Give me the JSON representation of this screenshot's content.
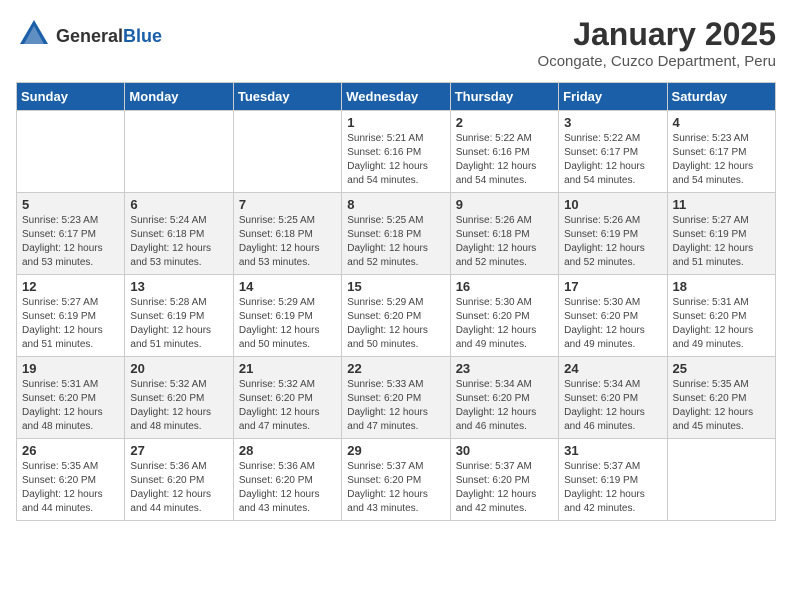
{
  "logo": {
    "general": "General",
    "blue": "Blue"
  },
  "header": {
    "month": "January 2025",
    "location": "Ocongate, Cuzco Department, Peru"
  },
  "weekdays": [
    "Sunday",
    "Monday",
    "Tuesday",
    "Wednesday",
    "Thursday",
    "Friday",
    "Saturday"
  ],
  "weeks": [
    [
      {
        "day": "",
        "sunrise": "",
        "sunset": "",
        "daylight": ""
      },
      {
        "day": "",
        "sunrise": "",
        "sunset": "",
        "daylight": ""
      },
      {
        "day": "",
        "sunrise": "",
        "sunset": "",
        "daylight": ""
      },
      {
        "day": "1",
        "sunrise": "Sunrise: 5:21 AM",
        "sunset": "Sunset: 6:16 PM",
        "daylight": "Daylight: 12 hours and 54 minutes."
      },
      {
        "day": "2",
        "sunrise": "Sunrise: 5:22 AM",
        "sunset": "Sunset: 6:16 PM",
        "daylight": "Daylight: 12 hours and 54 minutes."
      },
      {
        "day": "3",
        "sunrise": "Sunrise: 5:22 AM",
        "sunset": "Sunset: 6:17 PM",
        "daylight": "Daylight: 12 hours and 54 minutes."
      },
      {
        "day": "4",
        "sunrise": "Sunrise: 5:23 AM",
        "sunset": "Sunset: 6:17 PM",
        "daylight": "Daylight: 12 hours and 54 minutes."
      }
    ],
    [
      {
        "day": "5",
        "sunrise": "Sunrise: 5:23 AM",
        "sunset": "Sunset: 6:17 PM",
        "daylight": "Daylight: 12 hours and 53 minutes."
      },
      {
        "day": "6",
        "sunrise": "Sunrise: 5:24 AM",
        "sunset": "Sunset: 6:18 PM",
        "daylight": "Daylight: 12 hours and 53 minutes."
      },
      {
        "day": "7",
        "sunrise": "Sunrise: 5:25 AM",
        "sunset": "Sunset: 6:18 PM",
        "daylight": "Daylight: 12 hours and 53 minutes."
      },
      {
        "day": "8",
        "sunrise": "Sunrise: 5:25 AM",
        "sunset": "Sunset: 6:18 PM",
        "daylight": "Daylight: 12 hours and 52 minutes."
      },
      {
        "day": "9",
        "sunrise": "Sunrise: 5:26 AM",
        "sunset": "Sunset: 6:18 PM",
        "daylight": "Daylight: 12 hours and 52 minutes."
      },
      {
        "day": "10",
        "sunrise": "Sunrise: 5:26 AM",
        "sunset": "Sunset: 6:19 PM",
        "daylight": "Daylight: 12 hours and 52 minutes."
      },
      {
        "day": "11",
        "sunrise": "Sunrise: 5:27 AM",
        "sunset": "Sunset: 6:19 PM",
        "daylight": "Daylight: 12 hours and 51 minutes."
      }
    ],
    [
      {
        "day": "12",
        "sunrise": "Sunrise: 5:27 AM",
        "sunset": "Sunset: 6:19 PM",
        "daylight": "Daylight: 12 hours and 51 minutes."
      },
      {
        "day": "13",
        "sunrise": "Sunrise: 5:28 AM",
        "sunset": "Sunset: 6:19 PM",
        "daylight": "Daylight: 12 hours and 51 minutes."
      },
      {
        "day": "14",
        "sunrise": "Sunrise: 5:29 AM",
        "sunset": "Sunset: 6:19 PM",
        "daylight": "Daylight: 12 hours and 50 minutes."
      },
      {
        "day": "15",
        "sunrise": "Sunrise: 5:29 AM",
        "sunset": "Sunset: 6:20 PM",
        "daylight": "Daylight: 12 hours and 50 minutes."
      },
      {
        "day": "16",
        "sunrise": "Sunrise: 5:30 AM",
        "sunset": "Sunset: 6:20 PM",
        "daylight": "Daylight: 12 hours and 49 minutes."
      },
      {
        "day": "17",
        "sunrise": "Sunrise: 5:30 AM",
        "sunset": "Sunset: 6:20 PM",
        "daylight": "Daylight: 12 hours and 49 minutes."
      },
      {
        "day": "18",
        "sunrise": "Sunrise: 5:31 AM",
        "sunset": "Sunset: 6:20 PM",
        "daylight": "Daylight: 12 hours and 49 minutes."
      }
    ],
    [
      {
        "day": "19",
        "sunrise": "Sunrise: 5:31 AM",
        "sunset": "Sunset: 6:20 PM",
        "daylight": "Daylight: 12 hours and 48 minutes."
      },
      {
        "day": "20",
        "sunrise": "Sunrise: 5:32 AM",
        "sunset": "Sunset: 6:20 PM",
        "daylight": "Daylight: 12 hours and 48 minutes."
      },
      {
        "day": "21",
        "sunrise": "Sunrise: 5:32 AM",
        "sunset": "Sunset: 6:20 PM",
        "daylight": "Daylight: 12 hours and 47 minutes."
      },
      {
        "day": "22",
        "sunrise": "Sunrise: 5:33 AM",
        "sunset": "Sunset: 6:20 PM",
        "daylight": "Daylight: 12 hours and 47 minutes."
      },
      {
        "day": "23",
        "sunrise": "Sunrise: 5:34 AM",
        "sunset": "Sunset: 6:20 PM",
        "daylight": "Daylight: 12 hours and 46 minutes."
      },
      {
        "day": "24",
        "sunrise": "Sunrise: 5:34 AM",
        "sunset": "Sunset: 6:20 PM",
        "daylight": "Daylight: 12 hours and 46 minutes."
      },
      {
        "day": "25",
        "sunrise": "Sunrise: 5:35 AM",
        "sunset": "Sunset: 6:20 PM",
        "daylight": "Daylight: 12 hours and 45 minutes."
      }
    ],
    [
      {
        "day": "26",
        "sunrise": "Sunrise: 5:35 AM",
        "sunset": "Sunset: 6:20 PM",
        "daylight": "Daylight: 12 hours and 44 minutes."
      },
      {
        "day": "27",
        "sunrise": "Sunrise: 5:36 AM",
        "sunset": "Sunset: 6:20 PM",
        "daylight": "Daylight: 12 hours and 44 minutes."
      },
      {
        "day": "28",
        "sunrise": "Sunrise: 5:36 AM",
        "sunset": "Sunset: 6:20 PM",
        "daylight": "Daylight: 12 hours and 43 minutes."
      },
      {
        "day": "29",
        "sunrise": "Sunrise: 5:37 AM",
        "sunset": "Sunset: 6:20 PM",
        "daylight": "Daylight: 12 hours and 43 minutes."
      },
      {
        "day": "30",
        "sunrise": "Sunrise: 5:37 AM",
        "sunset": "Sunset: 6:20 PM",
        "daylight": "Daylight: 12 hours and 42 minutes."
      },
      {
        "day": "31",
        "sunrise": "Sunrise: 5:37 AM",
        "sunset": "Sunset: 6:19 PM",
        "daylight": "Daylight: 12 hours and 42 minutes."
      },
      {
        "day": "",
        "sunrise": "",
        "sunset": "",
        "daylight": ""
      }
    ]
  ]
}
